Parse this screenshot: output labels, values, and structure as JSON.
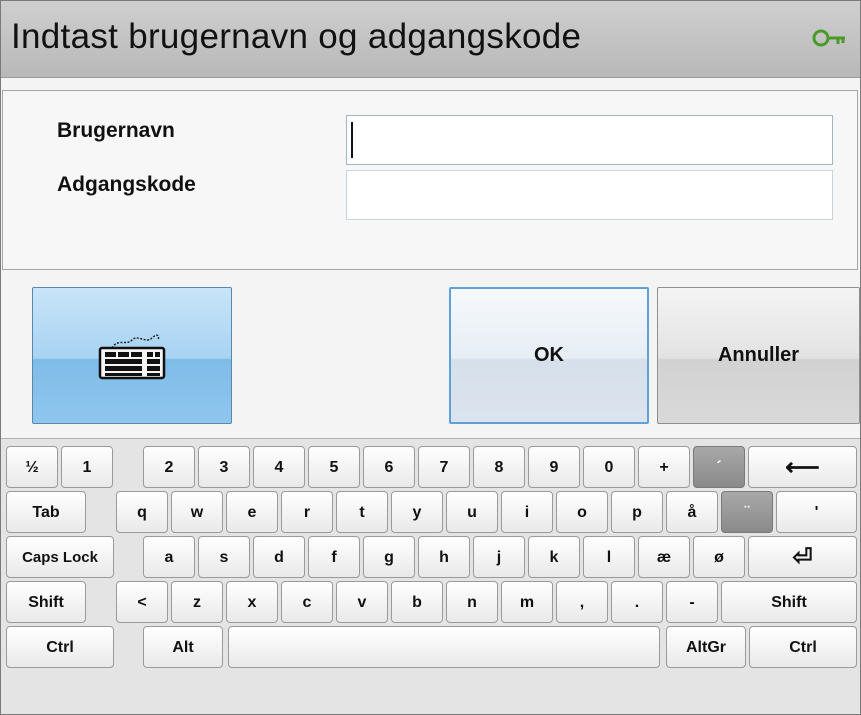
{
  "dialog": {
    "title": "Indtast brugernavn og adgangskode",
    "title_icon": "key-icon"
  },
  "form": {
    "username_label": "Brugernavn",
    "username_value": "",
    "password_label": "Adgangskode",
    "password_value": ""
  },
  "buttons": {
    "keyboard_toggle_icon": "keyboard-icon",
    "ok_label": "OK",
    "cancel_label": "Annuller"
  },
  "keyboard": {
    "row1": [
      "½",
      "1",
      "2",
      "3",
      "4",
      "5",
      "6",
      "7",
      "8",
      "9",
      "0",
      "+",
      "´",
      "⟵"
    ],
    "row2": [
      "Tab",
      "q",
      "w",
      "e",
      "r",
      "t",
      "y",
      "u",
      "i",
      "o",
      "p",
      "å",
      "¨",
      "'"
    ],
    "row3": [
      "Caps Lock",
      "a",
      "s",
      "d",
      "f",
      "g",
      "h",
      "j",
      "k",
      "l",
      "æ",
      "ø",
      "⏎"
    ],
    "row4": [
      "Shift",
      "<",
      "z",
      "x",
      "c",
      "v",
      "b",
      "n",
      "m",
      ",",
      ".",
      "-",
      "Shift"
    ],
    "row5": [
      "Ctrl",
      "Alt",
      "",
      "AltGr",
      "Ctrl"
    ]
  },
  "colors": {
    "titlebar": "#c4c4c4",
    "keyboard_button_active": "#8fc6ee",
    "ok_focus_border": "#5fa0d8",
    "dead_key": "#999999",
    "key_icon": "#4a9a2a"
  }
}
